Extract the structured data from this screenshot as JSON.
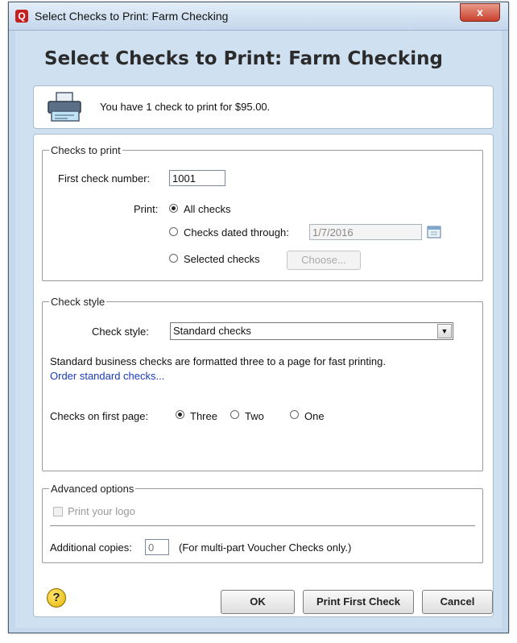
{
  "window": {
    "title": "Select Checks to Print: Farm Checking",
    "app_icon_letter": "Q",
    "close_label": "x"
  },
  "dialog": {
    "heading": "Select Checks to Print: Farm Checking",
    "info_text": "You have 1 check to print for $95.00."
  },
  "checks_to_print": {
    "legend": "Checks to print",
    "first_check_label": "First check number:",
    "first_check_value": "1001",
    "print_label": "Print:",
    "options": [
      {
        "label": "All checks",
        "selected": true
      },
      {
        "label": "Checks dated through:",
        "selected": false
      },
      {
        "label": "Selected checks",
        "selected": false
      }
    ],
    "date_value": "1/7/2016",
    "choose_button": "Choose..."
  },
  "check_style": {
    "legend": "Check style",
    "label": "Check style:",
    "selected": "Standard checks",
    "description": "Standard business checks are formatted three to a page for fast printing.",
    "order_link": "Order standard checks...",
    "first_page_label": "Checks on first page:",
    "first_page_options": [
      {
        "label": "Three",
        "selected": true
      },
      {
        "label": "Two",
        "selected": false
      },
      {
        "label": "One",
        "selected": false
      }
    ]
  },
  "advanced": {
    "legend": "Advanced options",
    "print_logo_label": "Print your logo",
    "print_logo_checked": false,
    "copies_label": "Additional copies:",
    "copies_value": "0",
    "copies_note": "(For multi-part Voucher Checks only.)"
  },
  "footer": {
    "help_symbol": "?",
    "ok_label": "OK",
    "print_first_label": "Print First Check",
    "cancel_label": "Cancel"
  },
  "icons": {
    "printer": "printer-icon",
    "calendar": "calendar-icon",
    "help": "help-icon",
    "dropdown": "chevron-down-icon"
  }
}
